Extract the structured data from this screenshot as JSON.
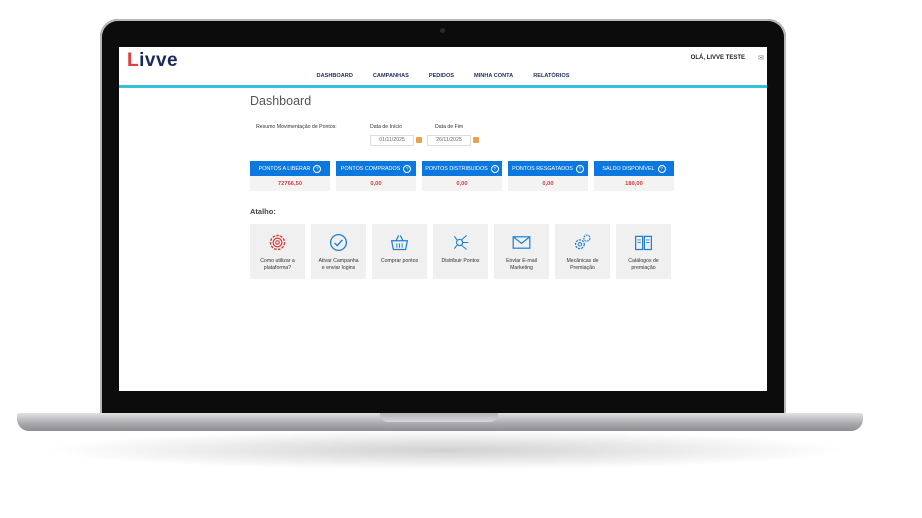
{
  "header": {
    "logo": "ivve",
    "logo_first": "L",
    "greeting": "OLÁ, LIVVE TESTE"
  },
  "nav": {
    "items": [
      "DASHBOARD",
      "CAMPANHAS",
      "PEDIDOS",
      "MINHA CONTA",
      "RELATÓRIOS"
    ]
  },
  "page": {
    "title": "Dashboard"
  },
  "filters": {
    "summary_label": "Resumo Movimentação de Pontos:",
    "start_label": "Data de Início",
    "end_label": "Data de Fim",
    "start_value": "01/11/2025",
    "end_value": "26/11/2025"
  },
  "cards": [
    {
      "label": "PONTOS A LIBERAR",
      "value": "72766,50"
    },
    {
      "label": "PONTOS COMPRADOS",
      "value": "0,00"
    },
    {
      "label": "PONTOS DISTRIBUIDOS",
      "value": "0,00"
    },
    {
      "label": "PONTOS RESGATADOS",
      "value": "0,00"
    },
    {
      "label": "SALDO DISPONÍVEL",
      "value": "180,00"
    }
  ],
  "shortcuts": {
    "title": "Atalho:",
    "items": [
      {
        "label": "Como utilizar a\nplataforma?",
        "icon": "gear-icon"
      },
      {
        "label": "Ativar Campanha\ne enviar logins",
        "icon": "check-circle-icon"
      },
      {
        "label": "Comprar pontos",
        "icon": "basket-icon"
      },
      {
        "label": "Distribuir Pontos",
        "icon": "distribute-icon"
      },
      {
        "label": "Enviar E-mail\nMarketing",
        "icon": "envelope-icon"
      },
      {
        "label": "Mecânicas de\nPremiação",
        "icon": "gears-icon"
      },
      {
        "label": "Catálogos de\npremiação",
        "icon": "book-icon"
      }
    ]
  },
  "colors": {
    "brand_blue": "#0b78e0",
    "accent_cyan": "#33c1de",
    "value_red": "#d63a3a"
  }
}
